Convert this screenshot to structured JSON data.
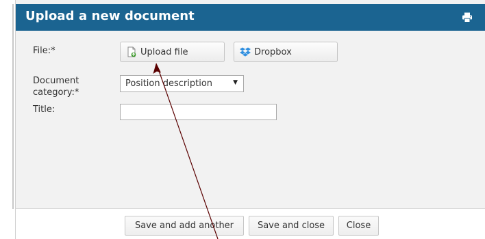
{
  "dialog": {
    "title": "Upload a new document"
  },
  "form": {
    "file_label": "File:*",
    "upload_button_label": "Upload file",
    "dropbox_button_label": "Dropbox",
    "category_label_line1": "Document",
    "category_label_line2": "category:*",
    "category_selected": "Position description",
    "title_label": "Title:",
    "title_value": ""
  },
  "footer": {
    "save_add_label": "Save and add another",
    "save_close_label": "Save and close",
    "close_label": "Close"
  },
  "colors": {
    "titlebar": "#1b6491",
    "annotation_arrow": "#5a0000"
  },
  "icons": {
    "print": "print-icon",
    "upload": "upload-file-icon",
    "dropbox": "dropbox-icon",
    "dropdown": "chevron-down-icon"
  }
}
